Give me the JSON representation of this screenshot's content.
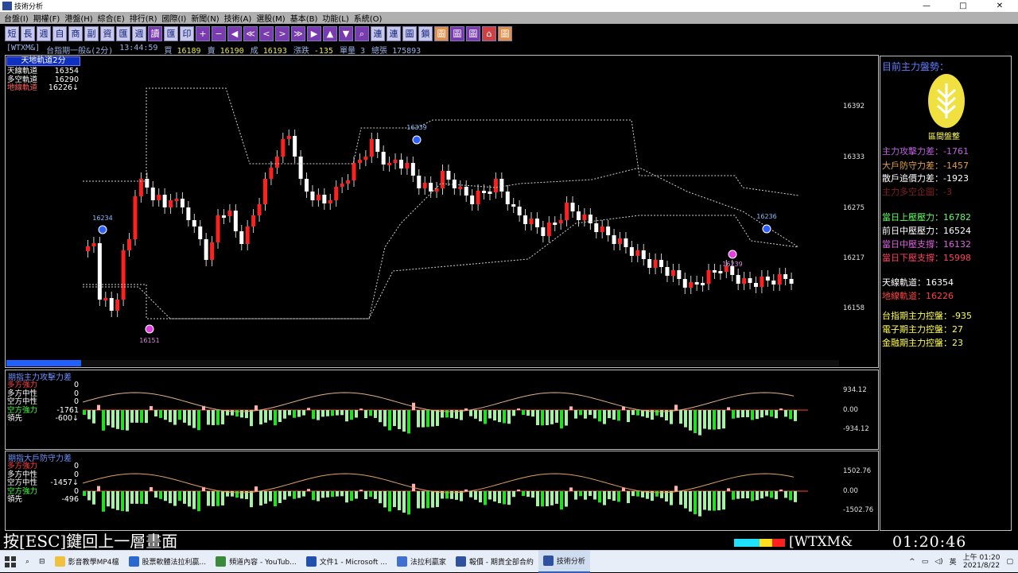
{
  "window": {
    "title": "技術分析",
    "min": "—",
    "max": "□",
    "close": "✕"
  },
  "menu": [
    "台盤(I)",
    "期權(F)",
    "港盤(H)",
    "綜合(E)",
    "排行(R)",
    "國際(I)",
    "新聞(N)",
    "技術(A)",
    "選股(M)",
    "基本(B)",
    "功能(L)",
    "系統(O)"
  ],
  "toolbar": [
    {
      "label": "短",
      "style": ""
    },
    {
      "label": "長",
      "style": ""
    },
    {
      "label": "週",
      "style": ""
    },
    {
      "label": "自",
      "style": ""
    },
    {
      "label": "商",
      "style": ""
    },
    {
      "label": "副",
      "style": ""
    },
    {
      "label": "資",
      "style": ""
    },
    {
      "label": "匯",
      "style": ""
    },
    {
      "label": "週",
      "style": ""
    },
    {
      "label": "讀",
      "style": "purple"
    },
    {
      "label": "匯",
      "style": ""
    },
    {
      "label": "印",
      "style": ""
    },
    {
      "label": "+",
      "style": "purple"
    },
    {
      "label": "−",
      "style": "purple"
    },
    {
      "label": "◀",
      "style": "purple"
    },
    {
      "label": "≪",
      "style": "purple"
    },
    {
      "label": "<",
      "style": "purple"
    },
    {
      "label": ">",
      "style": "purple"
    },
    {
      "label": "≫",
      "style": "purple"
    },
    {
      "label": "▶",
      "style": "purple"
    },
    {
      "label": "▲",
      "style": "purple"
    },
    {
      "label": "▼",
      "style": "purple"
    },
    {
      "label": "⌕",
      "style": "purple"
    },
    {
      "label": "連",
      "style": ""
    },
    {
      "label": "連",
      "style": ""
    },
    {
      "label": "圖",
      "style": ""
    },
    {
      "label": "鎖",
      "style": ""
    },
    {
      "label": "圖",
      "style": "orange"
    },
    {
      "label": "圖",
      "style": "purple"
    },
    {
      "label": "圖",
      "style": "purple"
    },
    {
      "label": "⌂",
      "style": "red"
    },
    {
      "label": "圖",
      "style": "orange"
    }
  ],
  "status": {
    "symbol": "[WTXM&]",
    "name": "台指期一般&(2分)",
    "time": "13:44:59",
    "buy_label": "買",
    "buy": "16189",
    "sell_label": "賣",
    "sell": "16190",
    "deal_label": "成",
    "deal": "16193",
    "change_label": "漲跌",
    "change": "-135",
    "vol_label": "單量",
    "vol": "3",
    "total_label": "總張",
    "total": "175893"
  },
  "main_chart": {
    "legend_title": "天地軌道2分",
    "legend": [
      {
        "label": "天線軌道",
        "value": "16354",
        "color": "#ffffff"
      },
      {
        "label": "多空軌道",
        "value": "16290",
        "color": "#ffffff"
      },
      {
        "label": "地線軌道",
        "value": "16226↓",
        "color": "#ff6060"
      }
    ],
    "y_ticks": [
      "16392",
      "16333",
      "16275",
      "16217",
      "16158"
    ],
    "markers": [
      "16234",
      "16151",
      "16339",
      "16236",
      "16239"
    ]
  },
  "attack_panel": {
    "title": "期指主力攻擊力差",
    "rows": [
      {
        "label": "多方強力",
        "value": "0",
        "color": "#ff4040"
      },
      {
        "label": "多方中性",
        "value": "0",
        "color": "#ffffff"
      },
      {
        "label": "空方中性",
        "value": "0",
        "color": "#ffffff"
      },
      {
        "label": "空方強力",
        "value": "-1761",
        "color": "#40ff40"
      },
      {
        "label": "領先",
        "value": "-600↓",
        "color": "#ffffff"
      }
    ],
    "y_ticks": [
      "934.12",
      "0.00",
      "-934.12"
    ]
  },
  "defense_panel": {
    "title": "期指大戶防守力差",
    "rows": [
      {
        "label": "多方強力",
        "value": "0",
        "color": "#ff4040"
      },
      {
        "label": "多方中性",
        "value": "0",
        "color": "#ffffff"
      },
      {
        "label": "空方中性",
        "value": "-1457↓",
        "color": "#ffffff"
      },
      {
        "label": "空方強力",
        "value": "0",
        "color": "#40ff40"
      },
      {
        "label": "領先",
        "value": "-496",
        "color": "#ffffff"
      }
    ],
    "y_ticks": [
      "1502.76",
      "0.00",
      "-1502.76"
    ]
  },
  "right_panel": {
    "title": "目前主力盤勢：",
    "badge_label": "區間盤整",
    "lines": [
      {
        "text": "主力攻擊力差：-1761",
        "color": "#c060e0"
      },
      {
        "text": "大戶防守力差：-1457",
        "color": "#e0a040"
      },
      {
        "text": "散戶追價力差：-1923",
        "color": "#ffffff"
      },
      {
        "text": "主力多空企圖：-3",
        "color": "#802020"
      },
      {
        "text": "當日上壓壓力：16782",
        "color": "#60ff60"
      },
      {
        "text": "前日中壓壓力：16524",
        "color": "#ffffff"
      },
      {
        "text": "當日中壓支撐：16132",
        "color": "#e060e0"
      },
      {
        "text": "當日下壓支撐：15998",
        "color": "#ff4060"
      },
      {
        "text": "天線軌道：16354",
        "color": "#ffffff"
      },
      {
        "text": "地線軌道：16226",
        "color": "#ff4040"
      },
      {
        "text": "台指期主力控盤：-935",
        "color": "#ffff40"
      },
      {
        "text": "電子期主力控盤：27",
        "color": "#ffff40"
      },
      {
        "text": "金融期主力控盤：23",
        "color": "#ffff40"
      }
    ]
  },
  "bottom": {
    "esc_text": "按[ESC]鍵回上一層畫面",
    "symbol": "WTXM&",
    "clock": "01:20:46"
  },
  "taskbar": {
    "items": [
      "影音教學MP4檔",
      "股票軟體法拉利贏...",
      "頻道內容 - YouTub...",
      "文件1 - Microsoft ...",
      "法拉利贏家",
      "報價 - 期貨全部合約",
      "技術分析"
    ],
    "time": "上午 01:20",
    "date": "2021/8/22",
    "ime": "英"
  }
}
